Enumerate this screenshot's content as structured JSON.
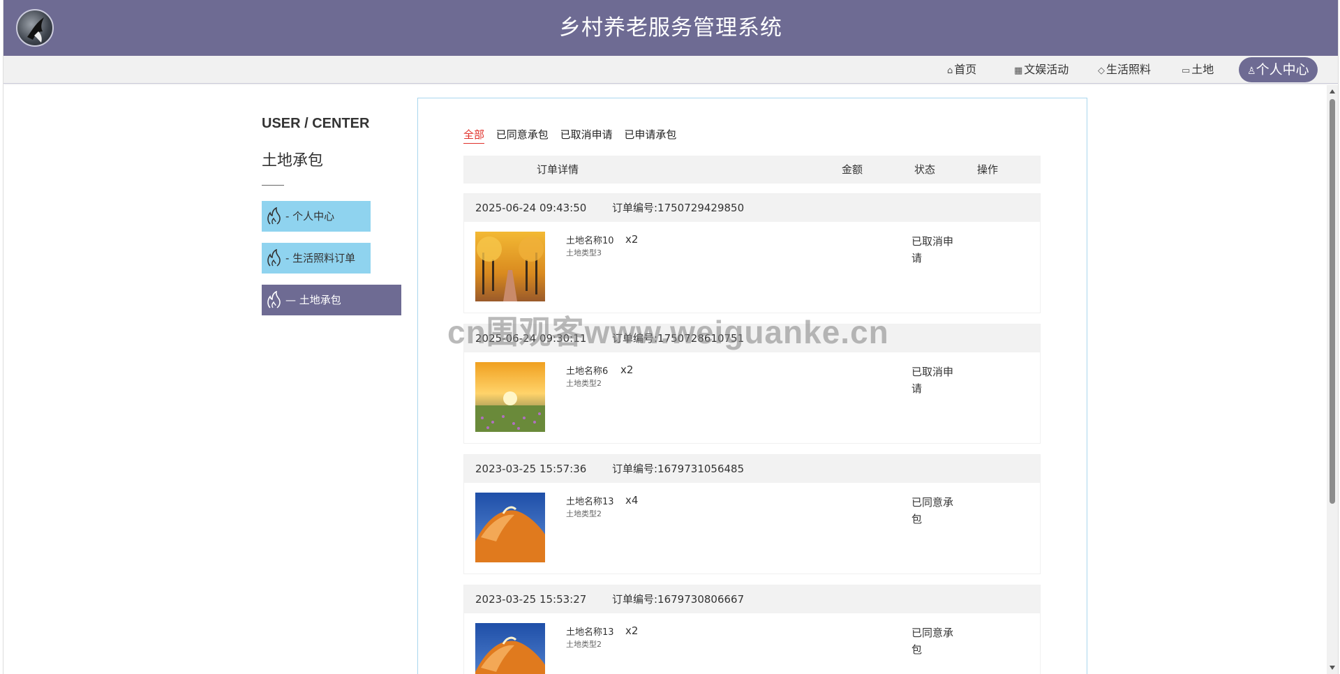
{
  "header": {
    "title": "乡村养老服务管理系统",
    "logo_icon": "eagle-logo-icon",
    "bg_color": "#6e6b93"
  },
  "nav": {
    "items": [
      {
        "label": "首页",
        "icon": "home-icon"
      },
      {
        "label": "文娱活动",
        "icon": "grid-icon"
      },
      {
        "label": "生活照料",
        "icon": "tag-icon"
      },
      {
        "label": "土地",
        "icon": "book-icon"
      }
    ],
    "active": {
      "label": "个人中心",
      "icon": "user-icon"
    }
  },
  "sidebar": {
    "title": "USER / CENTER",
    "subtitle": "土地承包",
    "items": [
      {
        "label": "-  个人中心",
        "icon": "flame-icon"
      },
      {
        "label": "-  生活照料订单",
        "icon": "flame-icon"
      },
      {
        "label": "—  土地承包",
        "icon": "flame-icon",
        "active": true
      }
    ],
    "accent": "#8fd3ef"
  },
  "tabs": [
    "全部",
    "已同意承包",
    "已取消申请",
    "已申请承包"
  ],
  "active_tab": "全部",
  "table": {
    "headers": {
      "detail": "订单详情",
      "amount": "金额",
      "status": "状态",
      "action": "操作"
    }
  },
  "orders": [
    {
      "time": "2025-06-24 09:43:50",
      "order_no": "订单编号:1750729429850",
      "name": "土地名称10",
      "type": "土地类型3",
      "qty": "x2",
      "status": "已取消申请",
      "image": "autumn-avenue"
    },
    {
      "time": "2025-06-24 09:30:11",
      "order_no": "订单编号:1750728610751",
      "name": "土地名称6",
      "type": "土地类型2",
      "qty": "x2",
      "status": "已取消申请",
      "image": "sunset-meadow"
    },
    {
      "time": "2023-03-25 15:57:36",
      "order_no": "订单编号:1679731056485",
      "name": "土地名称13",
      "type": "土地类型2",
      "qty": "x4",
      "status": "已同意承包",
      "image": "orange-rock"
    },
    {
      "time": "2023-03-25 15:53:27",
      "order_no": "订单编号:1679730806667",
      "name": "土地名称13",
      "type": "土地类型2",
      "qty": "x2",
      "status": "已同意承包",
      "image": "orange-rock"
    }
  ],
  "watermark": "cn围观客www.weiguanke.cn",
  "colors": {
    "active_tab": "#e0312b",
    "panel_border": "#a9d6ee"
  }
}
